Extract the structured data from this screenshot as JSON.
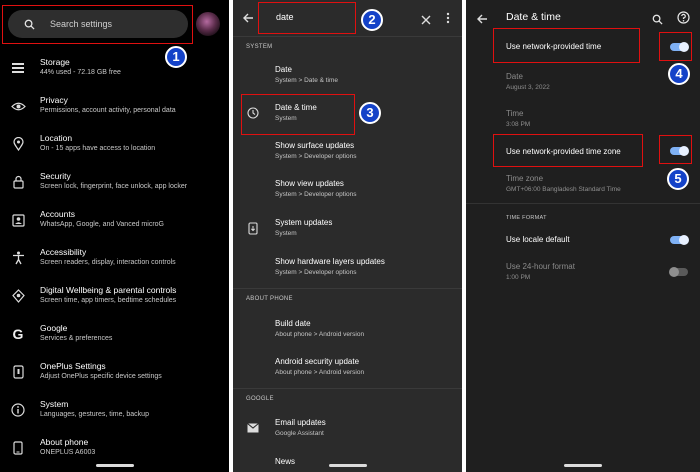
{
  "panel1": {
    "search_placeholder": "Search settings",
    "items": [
      {
        "title": "Storage",
        "subtitle": "44% used - 72.18 GB free",
        "icon": "storage-icon"
      },
      {
        "title": "Privacy",
        "subtitle": "Permissions, account activity, personal data",
        "icon": "privacy-icon"
      },
      {
        "title": "Location",
        "subtitle": "On - 15 apps have access to location",
        "icon": "location-icon"
      },
      {
        "title": "Security",
        "subtitle": "Screen lock, fingerprint, face unlock, app locker",
        "icon": "lock-icon"
      },
      {
        "title": "Accounts",
        "subtitle": "WhatsApp, Google, and Vanced microG",
        "icon": "accounts-icon"
      },
      {
        "title": "Accessibility",
        "subtitle": "Screen readers, display, interaction controls",
        "icon": "accessibility-icon"
      },
      {
        "title": "Digital Wellbeing & parental controls",
        "subtitle": "Screen time, app timers, bedtime schedules",
        "icon": "wellbeing-icon"
      },
      {
        "title": "Google",
        "subtitle": "Services & preferences",
        "icon": "google-icon"
      },
      {
        "title": "OnePlus Settings",
        "subtitle": "Adjust OnePlus specific device settings",
        "icon": "oneplus-icon"
      },
      {
        "title": "System",
        "subtitle": "Languages, gestures, time, backup",
        "icon": "info-icon"
      },
      {
        "title": "About phone",
        "subtitle": "ONEPLUS A6003",
        "icon": "phone-icon"
      }
    ]
  },
  "panel2": {
    "query": "date",
    "sections": {
      "system": "SYSTEM",
      "about_phone": "ABOUT PHONE",
      "google": "GOOGLE"
    },
    "results": [
      {
        "title": "Date",
        "subtitle": "System > Date & time",
        "icon": ""
      },
      {
        "title": "Date & time",
        "subtitle": "System",
        "icon": "clock-icon"
      },
      {
        "title": "Show surface updates",
        "subtitle": "System > Developer options",
        "icon": ""
      },
      {
        "title": "Show view updates",
        "subtitle": "System > Developer options",
        "icon": ""
      },
      {
        "title": "System updates",
        "subtitle": "System",
        "icon": "system-update-icon"
      },
      {
        "title": "Show hardware layers updates",
        "subtitle": "System > Developer options",
        "icon": ""
      },
      {
        "title": "Build date",
        "subtitle": "About phone > Android version",
        "icon": ""
      },
      {
        "title": "Android security update",
        "subtitle": "About phone > Android version",
        "icon": ""
      },
      {
        "title": "Email updates",
        "subtitle": "Google Assistant",
        "icon": "mail-icon"
      },
      {
        "title": "News",
        "subtitle": "",
        "icon": ""
      }
    ]
  },
  "panel3": {
    "title": "Date & time",
    "items": [
      {
        "title": "Use network-provided time",
        "subtitle": "",
        "toggle": true
      },
      {
        "title": "Date",
        "subtitle": "August 3, 2022"
      },
      {
        "title": "Time",
        "subtitle": "3:08 PM"
      },
      {
        "title": "Use network-provided time zone",
        "subtitle": "",
        "toggle": true
      },
      {
        "title": "Time zone",
        "subtitle": "GMT+06:00 Bangladesh Standard Time"
      },
      {
        "title": "Use locale default",
        "subtitle": "",
        "toggle": true
      },
      {
        "title": "Use 24-hour format",
        "subtitle": "1:00 PM",
        "toggle": false
      }
    ],
    "section_time_format": "TIME FORMAT"
  },
  "badges": [
    "1",
    "2",
    "3",
    "4",
    "5"
  ],
  "colors": {
    "highlight": "#e01010",
    "badge": "#1442c8",
    "toggle_on": "#7fb1f5"
  }
}
